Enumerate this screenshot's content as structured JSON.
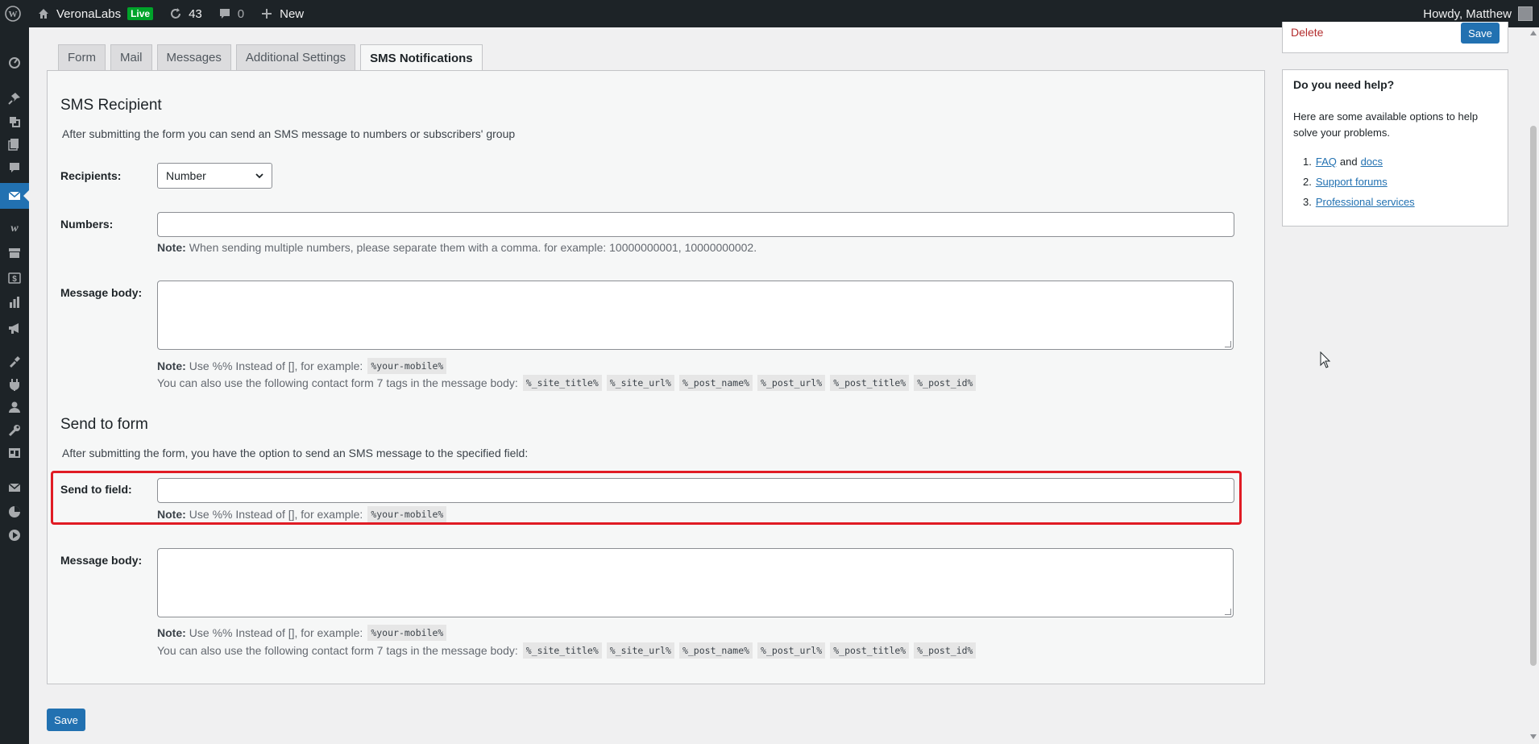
{
  "adminbar": {
    "site_name": "VeronaLabs",
    "live_badge": "Live",
    "updates_count": "43",
    "comments_count": "0",
    "new_label": "New",
    "greeting": "Howdy, Matthew"
  },
  "sidebar": {
    "icons": [
      "dashboard-icon",
      "pin-icon",
      "media-icon",
      "pages-icon",
      "comments-icon",
      "contact-mail-icon",
      "woo-icon",
      "archive-icon",
      "dollar-icon",
      "analytics-icon",
      "megaphone-icon",
      "appearance-icon",
      "plugins-icon",
      "users-icon",
      "tools-icon",
      "settings-icon",
      "mail-icon",
      "chart-icon",
      "play-icon"
    ],
    "active_index": 5
  },
  "tabs": [
    {
      "label": "Form",
      "active": false
    },
    {
      "label": "Mail",
      "active": false
    },
    {
      "label": "Messages",
      "active": false
    },
    {
      "label": "Additional Settings",
      "active": false
    },
    {
      "label": "SMS Notifications",
      "active": true
    }
  ],
  "sms_recipient": {
    "title": "SMS Recipient",
    "description": "After submitting the form you can send an SMS message to numbers or subscribers' group",
    "recipients_label": "Recipients:",
    "recipients_value": "Number",
    "numbers_label": "Numbers:",
    "numbers_value": "",
    "numbers_note_label": "Note:",
    "numbers_note_text": "When sending multiple numbers, please separate them with a comma. for example: 10000000001, 10000000002.",
    "message_label": "Message body:",
    "message_value": "",
    "message_note_label": "Note:",
    "message_note_text": "Use %% Instead of [], for example:",
    "message_note_code": "%your-mobile%",
    "tags_text": "You can also use the following contact form 7 tags in the message body:",
    "tags": [
      "%_site_title%",
      "%_site_url%",
      "%_post_name%",
      "%_post_url%",
      "%_post_title%",
      "%_post_id%"
    ]
  },
  "send_to_form": {
    "title": "Send to form",
    "description": "After submitting the form, you have the option to send an SMS message to the specified field:",
    "field_label": "Send to field:",
    "field_value": "",
    "field_note_label": "Note:",
    "field_note_text": "Use %% Instead of [], for example:",
    "field_note_code": "%your-mobile%",
    "message_label": "Message body:",
    "message_value": "",
    "message_note_label": "Note:",
    "message_note_text": "Use %% Instead of [], for example:",
    "message_note_code": "%your-mobile%",
    "tags_text": "You can also use the following contact form 7 tags in the message body:",
    "tags": [
      "%_site_title%",
      "%_site_url%",
      "%_post_name%",
      "%_post_url%",
      "%_post_title%",
      "%_post_id%"
    ]
  },
  "bottom_save_label": "Save",
  "publish_box": {
    "delete_label": "Delete",
    "save_label": "Save"
  },
  "help_box": {
    "title": "Do you need help?",
    "text": "Here are some available options to help solve your problems.",
    "items": [
      {
        "num": "1.",
        "link1": "FAQ",
        "and": "and",
        "link2": "docs"
      },
      {
        "num": "2.",
        "link1": "Support forums"
      },
      {
        "num": "3.",
        "link1": "Professional services"
      }
    ]
  },
  "colors": {
    "accent": "#2271b1",
    "highlight_border": "#e01b24",
    "adminbar_bg": "#1d2327",
    "delete": "#b32d2e"
  }
}
